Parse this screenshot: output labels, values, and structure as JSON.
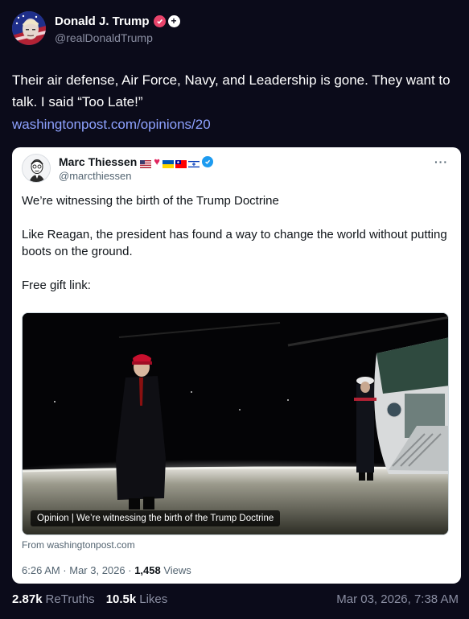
{
  "author": {
    "display_name": "Donald J. Trump",
    "handle": "@realDonaldTrump",
    "plus_glyph": "+"
  },
  "post": {
    "text": "Their air defense, Air Force, Navy, and Leadership is gone. They want to talk. I said “Too Late!”",
    "link": "washingtonpost.com/opinions/20"
  },
  "quoted": {
    "display_name": "Marc Thiessen",
    "handle": "@marcthiessen",
    "more": "···",
    "paragraphs": [
      "We’re witnessing the birth of the Trump Doctrine",
      "Like Reagan, the president has found a way to change the world without putting boots on the ground.",
      "Free gift link:"
    ],
    "media_caption": "Opinion | We’re witnessing the birth of the Trump Doctrine",
    "source": "From washingtonpost.com",
    "time": "6:26 AM · Mar 3, 2026 · ",
    "views_count": "1,458",
    "views_label": " Views"
  },
  "stats": {
    "retruths_count": "2.87k",
    "retruths_label": "ReTruths",
    "likes_count": "10.5k",
    "likes_label": "Likes"
  },
  "timestamp": "Mar 03, 2026, 7:38 AM",
  "colors": {
    "background": "#0b0b1a",
    "link": "#8ea2ff",
    "verified_truth": "#e8446b",
    "verified_x": "#1d9bf0"
  }
}
